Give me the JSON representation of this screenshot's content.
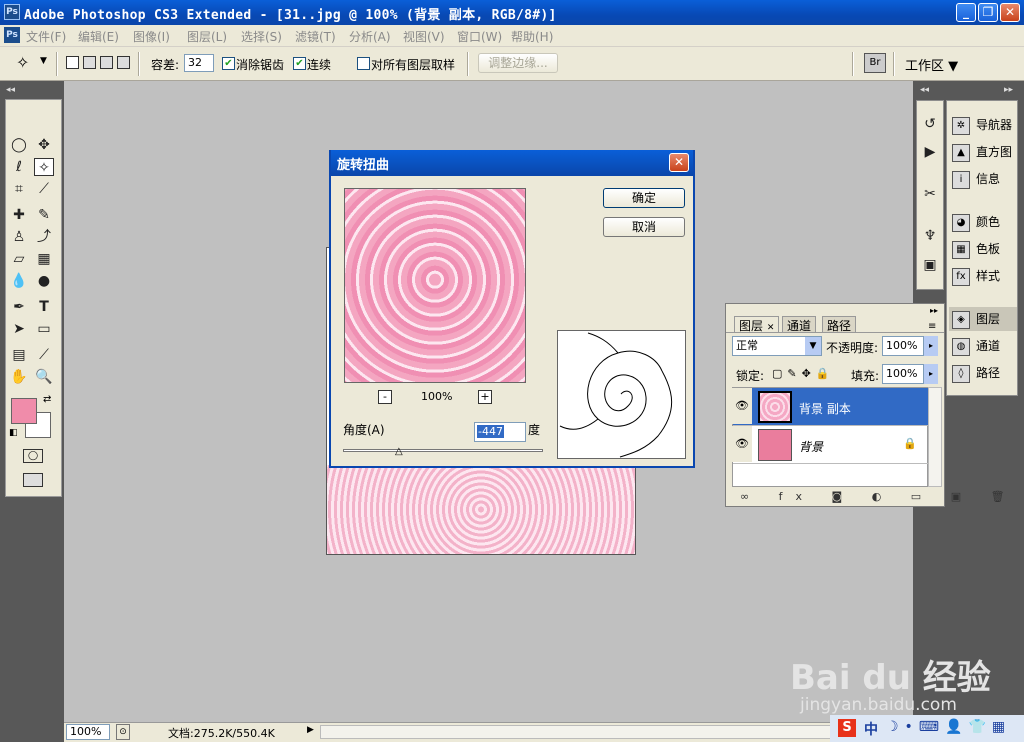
{
  "window": {
    "app_badge": "Ps",
    "title": "Adobe Photoshop CS3 Extended - [31..jpg @ 100% (背景 副本, RGB/8#)]",
    "controls": {
      "minimize": "_",
      "restore": "❐",
      "close": "✕"
    }
  },
  "menubar": {
    "items": [
      "文件(F)",
      "编辑(E)",
      "图像(I)",
      "图层(L)",
      "选择(S)",
      "滤镜(T)",
      "分析(A)",
      "视图(V)",
      "窗口(W)",
      "帮助(H)"
    ]
  },
  "options": {
    "tolerance_label": "容差:",
    "tolerance_value": "32",
    "antialias_label": "消除锯齿",
    "antialias_checked": true,
    "contiguous_label": "连续",
    "contiguous_checked": true,
    "sample_all_label": "对所有图层取样",
    "sample_all_checked": false,
    "refine_edge_label": "调整边缘...",
    "workspace_label": "工作区 ▼"
  },
  "dialog": {
    "title": "旋转扭曲",
    "ok_label": "确定",
    "cancel_label": "取消",
    "zoom_value": "100%",
    "zoom_minus": "-",
    "zoom_plus": "+",
    "angle_label": "角度(A)",
    "angle_value": "-447",
    "angle_unit": "度",
    "close": "✕"
  },
  "right_panels": {
    "items": [
      {
        "label": "导航器",
        "icon": "navigator-icon"
      },
      {
        "label": "直方图",
        "icon": "histogram-icon"
      },
      {
        "label": "信息",
        "icon": "info-icon"
      },
      {
        "label": "颜色",
        "icon": "color-icon"
      },
      {
        "label": "色板",
        "icon": "swatches-icon"
      },
      {
        "label": "样式",
        "icon": "styles-icon"
      },
      {
        "label": "图层",
        "icon": "layers-icon"
      },
      {
        "label": "通道",
        "icon": "channels-icon"
      },
      {
        "label": "路径",
        "icon": "paths-icon"
      }
    ]
  },
  "layers_panel": {
    "tabs": [
      "图层",
      "通道",
      "路径"
    ],
    "tab_close": "✕",
    "blend_mode": "正常",
    "opacity_label": "不透明度:",
    "opacity_value": "100%",
    "lock_label": "锁定:",
    "fill_label": "填充:",
    "fill_value": "100%",
    "layers": [
      {
        "name": "背景 副本",
        "selected": true,
        "locked": false
      },
      {
        "name": "背景",
        "selected": false,
        "locked": true
      }
    ]
  },
  "statusbar": {
    "zoom": "100%",
    "doc_info": "文档:275.2K/550.4K"
  },
  "taskbar": {
    "ime": "中"
  },
  "watermark": {
    "brand": "Bai du 经验",
    "url": "jingyan.baidu.com"
  },
  "colors": {
    "foreground": "#f08caa",
    "background": "#ffffff",
    "selected_layer": "#316ac5",
    "title_blue": "#0a52c8"
  }
}
